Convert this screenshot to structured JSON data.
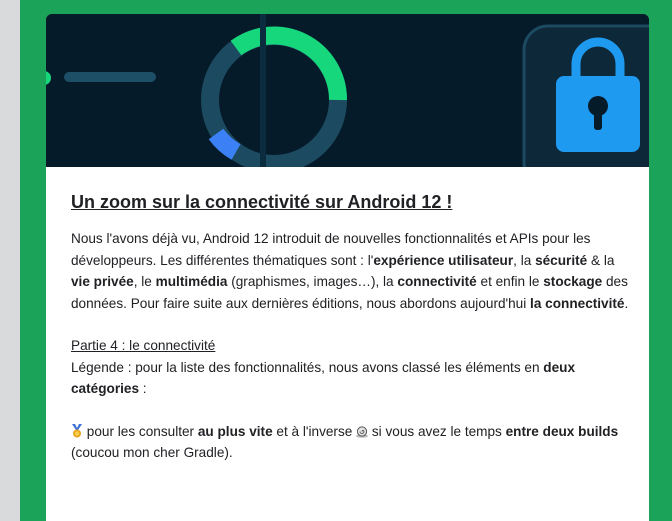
{
  "article": {
    "title": "Un zoom sur la connectivité sur Android 12 !",
    "intro": {
      "t1": "Nous l'avons déjà vu, Android 12 introduit de nouvelles fonctionnalités et APIs pour les développeurs. Les différentes thématiques sont : l'",
      "b1": "expérience utilisateur",
      "t2": ", la ",
      "b2": "sécurité",
      "t3": " & la ",
      "b3": "vie privée",
      "t4": ", le ",
      "b4": "multimédia",
      "t5": " (graphismes, images…), la ",
      "b5": "connectivité",
      "t6": " et enfin le ",
      "b6": "stockage",
      "t7": " des données. Pour faire suite aux dernières éditions, nous abordons aujourd'hui ",
      "b7": "la connectivité",
      "t8": "."
    },
    "part_heading": "Partie 4 : le connectivité",
    "legend": {
      "t1": "Légende : pour la liste des fonctionnalités, nous avons classé les éléments en ",
      "b1": "deux catégories",
      "t2": " :"
    },
    "categories": {
      "t1": " pour les consulter ",
      "b1": "au plus vite",
      "t2": " et à l'inverse ",
      "t3": " si vous avez le temps ",
      "b2": "entre deux builds",
      "t4": " (coucou mon cher Gradle)."
    }
  },
  "icons": {
    "fast": "medal-icon",
    "slow": "snail-icon",
    "banner": "padlock-icon"
  },
  "colors": {
    "frame": "#1ba35a",
    "banner_bg": "#061b2a",
    "accent_green": "#17d77c",
    "accent_blue": "#3c80f5",
    "lock_blue": "#1e9bf0"
  }
}
